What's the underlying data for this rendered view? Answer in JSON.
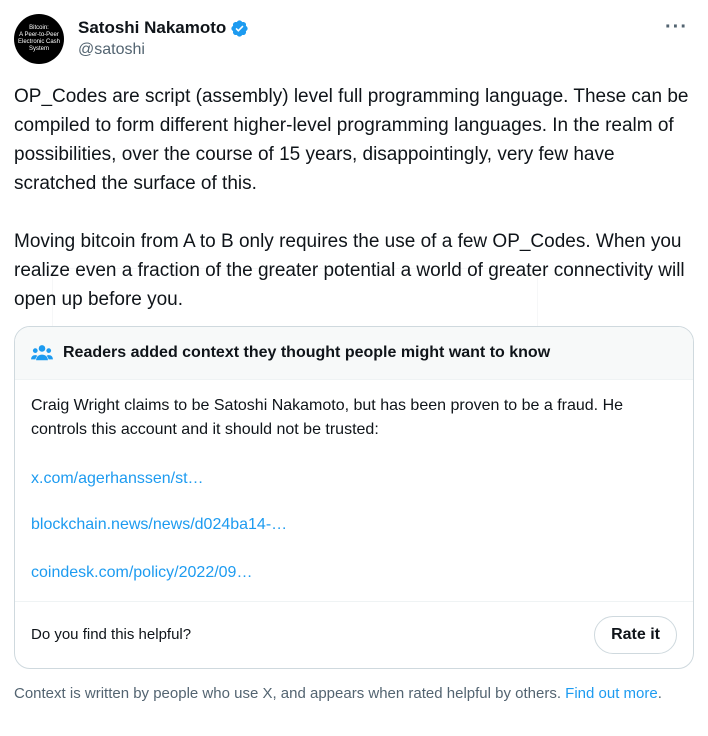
{
  "author": {
    "display_name": "Satoshi Nakamoto",
    "handle": "@satoshi",
    "avatar_text": [
      "Bitcoin:",
      "A Peer-to-Peer",
      "Electronic Cash",
      "System"
    ]
  },
  "tweet": {
    "paragraphs": [
      "OP_Codes are script (assembly) level full programming language.  These can be compiled to form different higher-level programming languages.  In the realm of possibilities, over the course of 15 years, disappointingly, very few have scratched the surface of this.",
      "Moving bitcoin from A to B only requires the use of a few OP_Codes.  When you realize even a fraction of the greater potential a world of greater connectivity will open up before you."
    ]
  },
  "community_note": {
    "title": "Readers added context they thought people might want to know",
    "text": "Craig Wright claims to be Satoshi Nakamoto, but has been proven to be a fraud. He controls this account and it should not be trusted:",
    "links": [
      "x.com/agerhanssen/st…",
      "blockchain.news/news/d024ba14-…",
      "coindesk.com/policy/2022/09…"
    ],
    "helpful_question": "Do you find this helpful?",
    "rate_button": "Rate it"
  },
  "footer": {
    "context_text": "Context is written by people who use X, and appears when rated helpful by others. ",
    "find_out_more": "Find out more",
    "period": "."
  },
  "colors": {
    "accent": "#1d9bf0",
    "text": "#0f1419",
    "muted": "#536471",
    "border": "#cfd9de"
  }
}
